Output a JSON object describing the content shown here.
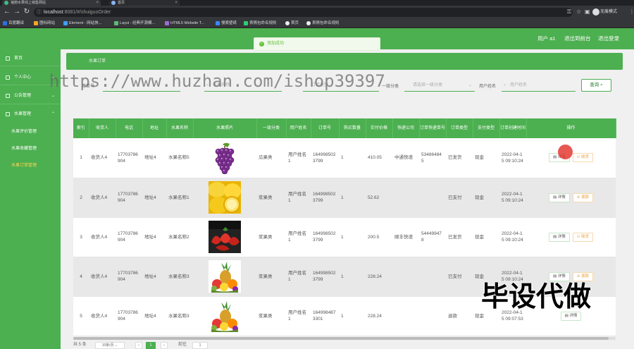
{
  "browser": {
    "tabs": [
      {
        "label": "袖丽水果线上销售网站",
        "icon": "vue-icon"
      },
      {
        "label": "首页",
        "icon": "page-icon"
      }
    ],
    "url_host": "localhost",
    "url_rest": ":8081/#/shuiguoOrder",
    "profile": "无痕模式",
    "bookmarks": [
      "百度翻译",
      "图标网站",
      "Element - 网站快...",
      "Layui - 经典开源模...",
      "HTML5 Website T...",
      "搜索壁纸",
      "表情包命名规则",
      "首页",
      "表情包命名规则"
    ]
  },
  "header": {
    "user": "用户 a1",
    "back_admin": "退出到前台",
    "logout": "退出登录"
  },
  "toast": {
    "text": "添加成功"
  },
  "sidebar": {
    "items": [
      {
        "label": "首页"
      },
      {
        "label": "个人中心"
      },
      {
        "label": "公告管理"
      },
      {
        "label": "水果管理"
      }
    ],
    "sub_items": [
      {
        "label": "水果评价管理"
      },
      {
        "label": "水果收藏管理"
      },
      {
        "label": "水果订单管理"
      }
    ]
  },
  "breadcrumb": "水果订单",
  "filters": {
    "order_label": "订单号",
    "l2_placeholder": "水果名称",
    "l3_placeholder": "订单类型",
    "cat_label": "一级分类",
    "cat_placeholder": "请选择一级分类",
    "user_label": "用户姓名",
    "user_placeholder": "用户姓名",
    "query": "查询"
  },
  "watermark": "https://www.huzhan.com/ishop39397",
  "watermark2": "毕设代做",
  "table": {
    "columns": [
      "索引",
      "收货人",
      "电话",
      "地址",
      "水果名称",
      "水果照片",
      "一级分类",
      "用户姓名",
      "订单号",
      "购买数量",
      "实付价格",
      "快递公司",
      "订单快递单号",
      "订单类型",
      "支付类型",
      "订单创建时间",
      "操作"
    ],
    "rows": [
      {
        "idx": "1",
        "name": "收货人4",
        "phone": "17703786904",
        "addr": "地址4",
        "fruit": "水果名称5",
        "photo": "grapes",
        "cat": "瓜果类",
        "user": "用户姓名1",
        "order": "1649985023799",
        "qty": "1",
        "price": "410.05",
        "express": "中通快递",
        "track": "534864845",
        "otype": "已发货",
        "ptype": "现金",
        "time": "2022-04-15 09:10:24",
        "acts": [
          "详情",
          "收货"
        ]
      },
      {
        "idx": "2",
        "name": "收货人4",
        "phone": "17703786904",
        "addr": "地址4",
        "fruit": "水果名称1",
        "photo": "lemons",
        "cat": "浆果类",
        "user": "用户姓名1",
        "order": "1649985023799",
        "qty": "1",
        "price": "52.62",
        "express": "",
        "track": "",
        "otype": "已支付",
        "ptype": "现金",
        "time": "2022-04-15 09:10:24",
        "acts": [
          "详情",
          "退款"
        ]
      },
      {
        "idx": "3",
        "name": "收货人4",
        "phone": "17703786904",
        "addr": "地址4",
        "fruit": "水果名称2",
        "photo": "strawberries",
        "cat": "浆果类",
        "user": "用户姓名1",
        "order": "1649985023799",
        "qty": "1",
        "price": "200.5",
        "express": "顺丰快递",
        "track": "544499478",
        "otype": "已发货",
        "ptype": "现金",
        "time": "2022-04-15 09:10:24",
        "acts": [
          "详情",
          "收货"
        ]
      },
      {
        "idx": "4",
        "name": "收货人4",
        "phone": "17703786904",
        "addr": "地址4",
        "fruit": "水果名称3",
        "photo": "mixed",
        "cat": "浆果类",
        "user": "用户姓名1",
        "order": "1649985023799",
        "qty": "1",
        "price": "228.24",
        "express": "",
        "track": "",
        "otype": "已支付",
        "ptype": "现金",
        "time": "2022-04-15 09:10:24",
        "acts": [
          "详情",
          "退款"
        ]
      },
      {
        "idx": "5",
        "name": "收货人4",
        "phone": "17703786904",
        "addr": "地址4",
        "fruit": "水果名称3",
        "photo": "mixed",
        "cat": "浆果类",
        "user": "用户姓名1",
        "order": "1649984873301",
        "qty": "1",
        "price": "228.24",
        "express": "",
        "track": "",
        "otype": "退款",
        "ptype": "现金",
        "time": "2022-04-15 09:07:53",
        "acts": [
          "详情"
        ]
      }
    ]
  },
  "pager": {
    "total": "共 5 条",
    "per_page": "10条/页",
    "current": "1",
    "goto": "前往",
    "page": "1"
  },
  "colors": {
    "primary": "#4caf50",
    "toast_green": "#67c23a",
    "active_sub": "#ffd54f"
  }
}
